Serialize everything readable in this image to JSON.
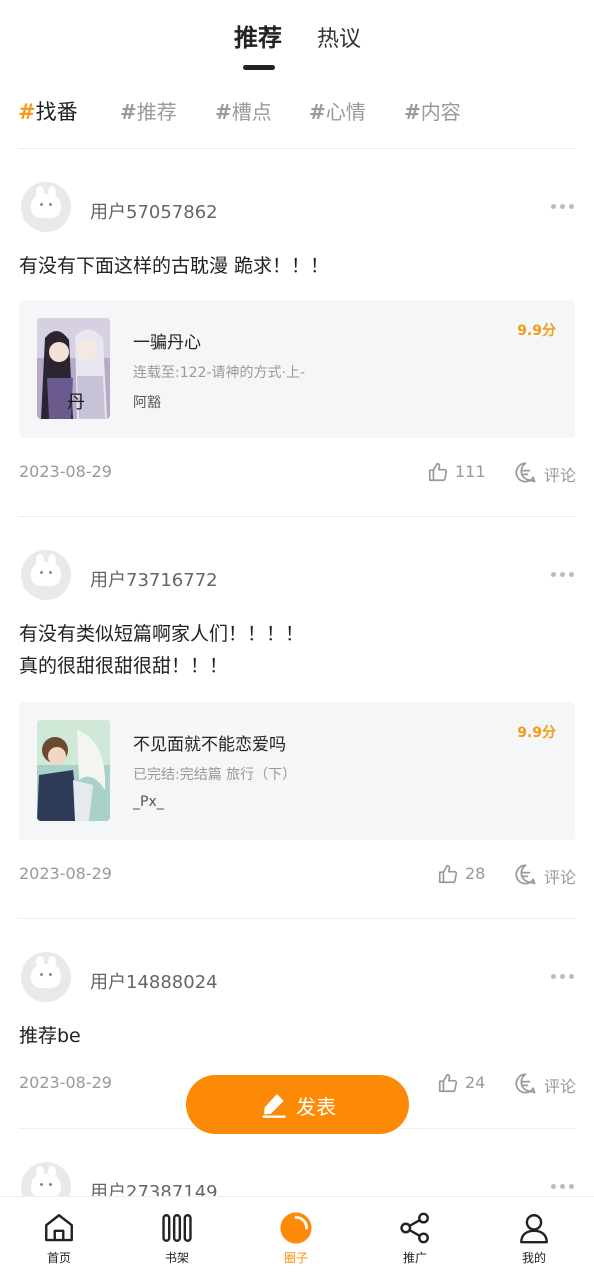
{
  "header": {
    "tabs": [
      {
        "label": "推荐",
        "active": true
      },
      {
        "label": "热议",
        "active": false
      }
    ]
  },
  "topics": [
    {
      "hash": "#",
      "label": "找番",
      "active": true
    },
    {
      "hash": "#",
      "label": "推荐",
      "active": false
    },
    {
      "hash": "#",
      "label": "槽点",
      "active": false
    },
    {
      "hash": "#",
      "label": "心情",
      "active": false
    },
    {
      "hash": "#",
      "label": "内容",
      "active": false
    }
  ],
  "posts": [
    {
      "username": "用户57057862",
      "lines": [
        "有没有下面这样的古耽漫 跪求！！！"
      ],
      "book": {
        "title": "一骗丹心",
        "chapter": "连载至:122-请神的方式·上-",
        "author": "阿豁",
        "score": "9.9分"
      },
      "date": "2023-08-29",
      "likes": "111",
      "comment_label": "评论"
    },
    {
      "username": "用户73716772",
      "lines": [
        "有没有类似短篇啊家人们！！！！",
        "真的很甜很甜很甜！！！"
      ],
      "book": {
        "title": "不见面就不能恋爱吗",
        "chapter": "已完结:完结篇 旅行（下）",
        "author": "_Px_",
        "score": "9.9分"
      },
      "date": "2023-08-29",
      "likes": "28",
      "comment_label": "评论"
    },
    {
      "username": "用户14888024",
      "lines": [
        "推荐be"
      ],
      "date": "2023-08-29",
      "likes": "24",
      "comment_label": "评论"
    },
    {
      "username": "用户27387149"
    }
  ],
  "fab": {
    "label": "发表",
    "icon": "edit-icon"
  },
  "bottom_nav": [
    {
      "label": "首页",
      "icon": "home-icon",
      "active": false
    },
    {
      "label": "书架",
      "icon": "bookshelf-icon",
      "active": false
    },
    {
      "label": "圈子",
      "icon": "circle-icon",
      "active": true
    },
    {
      "label": "推广",
      "icon": "share-icon",
      "active": false
    },
    {
      "label": "我的",
      "icon": "user-icon",
      "active": false
    }
  ],
  "colors": {
    "accent": "#fd8a07",
    "score": "#f39a18",
    "muted": "#999999"
  }
}
